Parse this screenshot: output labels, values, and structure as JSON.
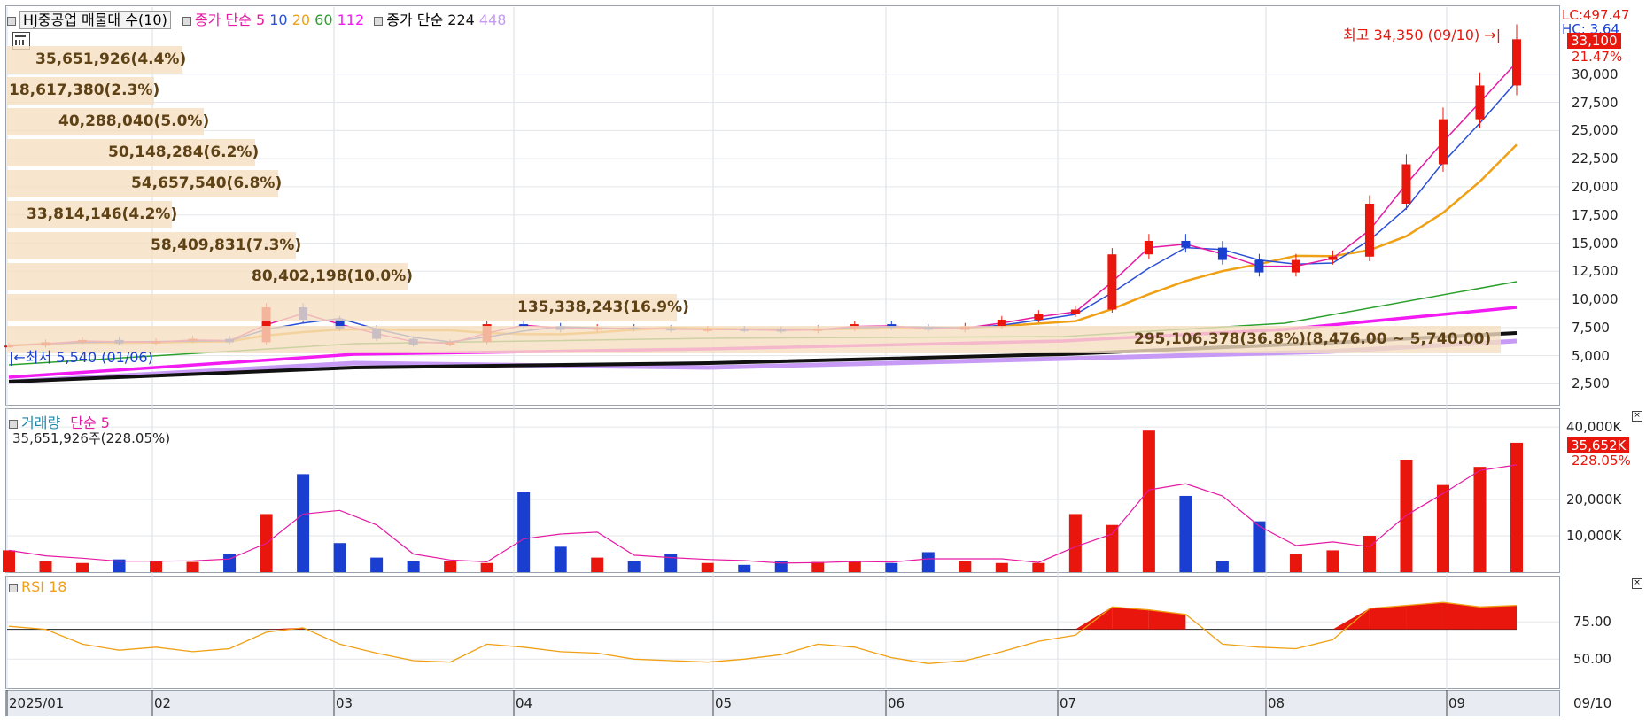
{
  "price_legend": {
    "dist_title": "HJ중공업 매물대 수(10)",
    "ma_label": "종가 단순",
    "ma_periods": [
      "5",
      "10",
      "20",
      "60",
      "112"
    ],
    "ma_colors": [
      "#e51aa3",
      "#2b4fd6",
      "#f0a014",
      "#2ca02c",
      "#f21cf2"
    ],
    "ma_long_label": "종가 단순",
    "ma_long_periods": [
      "224",
      "448"
    ],
    "ma_long_colors": [
      "#111111",
      "#c79af5"
    ]
  },
  "price_axis": {
    "ticks": [
      "30,000",
      "27,500",
      "25,000",
      "22,500",
      "20,000",
      "17,500",
      "15,000",
      "12,500",
      "10,000",
      "7,500",
      "5,000",
      "2,500"
    ],
    "lc": "LC:497.47",
    "hc": "HC: 3.64",
    "current_price": "33,100",
    "change_pct": "21.47%"
  },
  "annotations": {
    "high": "최고 34,350 (09/10)",
    "low": "최저 5,540 (01/06)"
  },
  "volume_profile": [
    {
      "label": "35,651,926(4.4%)"
    },
    {
      "label": "18,617,380(2.3%)"
    },
    {
      "label": "40,288,040(5.0%)"
    },
    {
      "label": "50,148,284(6.2%)"
    },
    {
      "label": "54,657,540(6.8%)"
    },
    {
      "label": "33,814,146(4.2%)"
    },
    {
      "label": "58,409,831(7.3%)"
    },
    {
      "label": "80,402,198(10.0%)"
    },
    {
      "label": "135,338,243(16.9%)"
    },
    {
      "label": "295,106,378(36.8%)(8,476.00 ~ 5,740.00)"
    }
  ],
  "volume_legend": {
    "title": "거래량",
    "ma": "단순 5",
    "current": "35,651,926주(228.05%)"
  },
  "volume_axis": {
    "ticks": [
      "40,000K",
      "20,000K",
      "10,000K"
    ],
    "current": "35,652K",
    "pct": "228.05%"
  },
  "rsi_legend": {
    "title": "RSI 18"
  },
  "rsi_axis": {
    "ticks": [
      "75.00",
      "50.00"
    ]
  },
  "x_axis": {
    "labels": [
      "2025/01",
      "02",
      "03",
      "04",
      "05",
      "06",
      "07",
      "08",
      "09"
    ],
    "end_label": "09/10"
  },
  "chart_data": {
    "type": "candlestick",
    "title": "HJ중공업",
    "xlabel": "",
    "ylabel": "",
    "ylim": [
      1200,
      35800
    ],
    "x": [
      "2025/01",
      "02",
      "03",
      "04",
      "05",
      "06",
      "07",
      "08",
      "09",
      "09/10"
    ],
    "series": [
      {
        "name": "close",
        "values": [
          5900,
          6200,
          6400,
          6100,
          6300,
          6500,
          6200,
          9300,
          8200,
          7400,
          6500,
          6000,
          6200,
          7800,
          7600,
          7300,
          7500,
          7400,
          7300,
          7350,
          7300,
          7200,
          7400,
          7800,
          7500,
          7300,
          7600,
          8200,
          8700,
          9100,
          14000,
          15200,
          14600,
          13500,
          12400,
          13500,
          13800,
          18500,
          22000,
          26000,
          29000,
          33100
        ]
      },
      {
        "name": "volume_k",
        "values": [
          6000,
          3000,
          2500,
          3500,
          3000,
          2800,
          5000,
          16000,
          27000,
          8000,
          4000,
          3000,
          3000,
          2500,
          22000,
          7000,
          4000,
          3000,
          5000,
          2500,
          2000,
          3000,
          2800,
          3000,
          2500,
          5500,
          3000,
          2500,
          2500,
          16000,
          13000,
          39000,
          21000,
          3000,
          14000,
          5000,
          6000,
          10000,
          31000,
          24000,
          29000,
          35652
        ]
      },
      {
        "name": "rsi",
        "values": [
          72,
          70,
          60,
          56,
          58,
          55,
          57,
          68,
          71,
          60,
          54,
          49,
          48,
          60,
          58,
          55,
          54,
          50,
          49,
          48,
          50,
          53,
          60,
          58,
          51,
          47,
          49,
          55,
          62,
          66,
          85,
          83,
          80,
          60,
          58,
          57,
          63,
          84,
          86,
          88,
          85,
          86
        ]
      }
    ]
  }
}
